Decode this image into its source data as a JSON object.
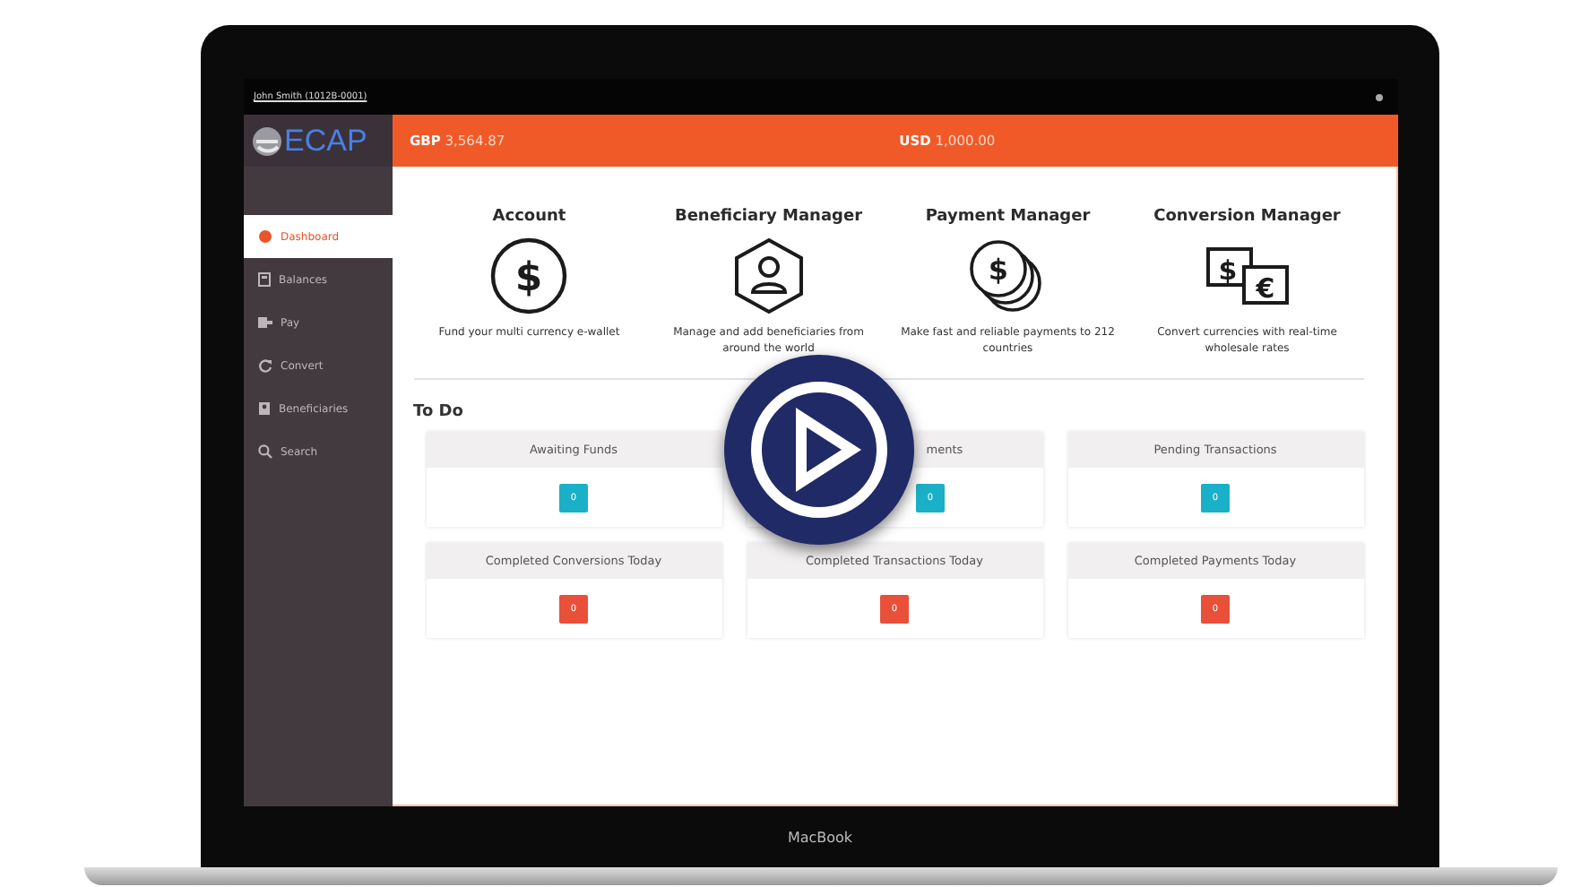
{
  "laptop": {
    "brand": "MacBook"
  },
  "top_bar": {
    "user": "John Smith (1012B-0001)"
  },
  "logo": {
    "text": "ECAP"
  },
  "header": {
    "balances": [
      {
        "currency": "GBP",
        "amount": "3,564.87"
      },
      {
        "currency": "USD",
        "amount": "1,000.00"
      }
    ]
  },
  "sidebar": {
    "items": [
      {
        "label": "Dashboard",
        "selected": true
      },
      {
        "label": "Balances",
        "selected": false
      },
      {
        "label": "Pay",
        "selected": false
      },
      {
        "label": "Convert",
        "selected": false
      },
      {
        "label": "Beneficiaries",
        "selected": false
      },
      {
        "label": "Search",
        "selected": false
      }
    ]
  },
  "features": [
    {
      "kind": "circle",
      "title": "Account",
      "symbols": [
        "$"
      ],
      "description": "Fund your multi currency e-wallet"
    },
    {
      "kind": "hexagon",
      "title": "Beneficiary Manager",
      "description": "Manage and add beneficiaries from around the world"
    },
    {
      "kind": "coins",
      "title": "Payment Manager",
      "symbols": [
        "$"
      ],
      "description": "Make fast and reliable payments to 212 countries"
    },
    {
      "kind": "notes",
      "title": "Conversion Manager",
      "symbols": [
        "$",
        "€"
      ],
      "description": "Convert currencies with real-time wholesale rates"
    }
  ],
  "todo": {
    "title": "To Do",
    "cards": [
      {
        "title": "Awaiting Funds",
        "count": "0",
        "color": "#1ab0c8"
      },
      {
        "title": "ments",
        "count": "0",
        "color": "#1ab0c8"
      },
      {
        "title": "Pending Transactions",
        "count": "0",
        "color": "#1ab0c8"
      },
      {
        "title": "Completed Conversions Today",
        "count": "0",
        "color": "#e8503a"
      },
      {
        "title": "Completed Transactions Today",
        "count": "0",
        "color": "#e8503a"
      },
      {
        "title": "Completed Payments Today",
        "count": "0",
        "color": "#e8503a"
      }
    ]
  },
  "video": {
    "play_button": true
  }
}
